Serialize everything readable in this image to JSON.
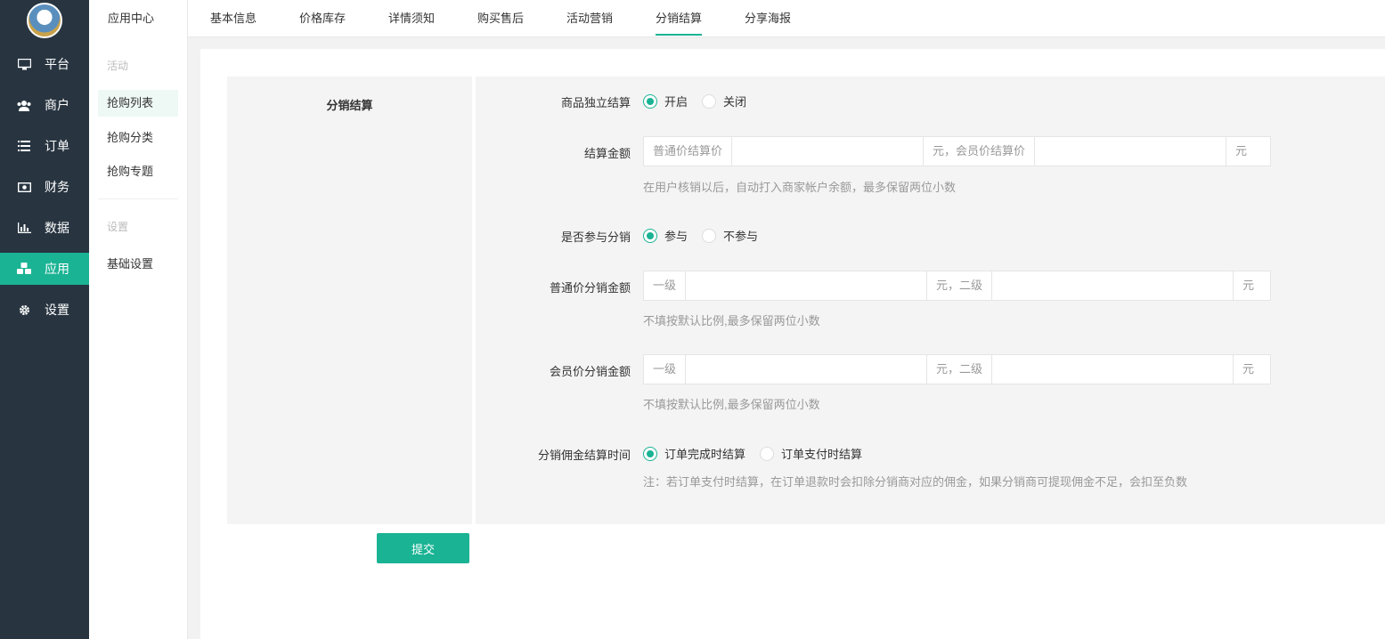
{
  "nav": {
    "items": [
      {
        "label": "平台",
        "icon": "monitor-icon"
      },
      {
        "label": "商户",
        "icon": "users-icon"
      },
      {
        "label": "订单",
        "icon": "list-icon"
      },
      {
        "label": "财务",
        "icon": "money-icon"
      },
      {
        "label": "数据",
        "icon": "bar-chart-icon"
      },
      {
        "label": "应用",
        "icon": "cubes-icon"
      },
      {
        "label": "设置",
        "icon": "gear-icon"
      }
    ],
    "active": "应用"
  },
  "subnav": {
    "title": "应用中心",
    "group1": "活动",
    "items1": [
      "抢购列表",
      "抢购分类",
      "抢购专题"
    ],
    "group2": "设置",
    "items2": [
      "基础设置"
    ]
  },
  "tabs": [
    "基本信息",
    "价格库存",
    "详情须知",
    "购买售后",
    "活动营销",
    "分销结算",
    "分享海报"
  ],
  "form": {
    "section_title": "分销结算",
    "independent": {
      "label": "商品独立结算",
      "on": "开启",
      "off": "关闭"
    },
    "amount": {
      "label": "结算金额",
      "prefix": "普通价结算价",
      "mid": "元，会员价结算价",
      "suffix": "元",
      "hint": "在用户核销以后，自动打入商家帐户余额，最多保留两位小数"
    },
    "join": {
      "label": "是否参与分销",
      "yes": "参与",
      "no": "不参与"
    },
    "normal_price": {
      "label": "普通价分销金额",
      "prefix": "一级",
      "mid": "元，二级",
      "suffix": "元",
      "hint": "不填按默认比例,最多保留两位小数"
    },
    "member_price": {
      "label": "会员价分销金额",
      "prefix": "一级",
      "mid": "元，二级",
      "suffix": "元",
      "hint": "不填按默认比例,最多保留两位小数"
    },
    "commission_time": {
      "label": "分销佣金结算时间",
      "opt1": "订单完成时结算",
      "opt2": "订单支付时结算",
      "hint": "注：若订单支付时结算，在订单退款时会扣除分销商对应的佣金，如果分销商可提现佣金不足，会扣至负数"
    },
    "submit": "提交"
  },
  "colors": {
    "accent": "#1ab394",
    "nav_bg": "#283541"
  }
}
